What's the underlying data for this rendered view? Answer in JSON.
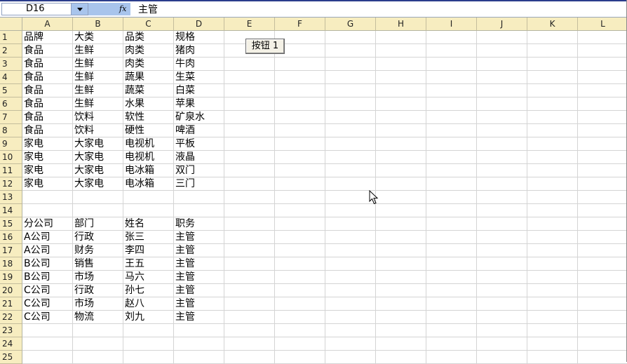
{
  "formula_bar": {
    "name_box_value": "D16",
    "fx_label": "fx",
    "content": "主管"
  },
  "columns": [
    "A",
    "B",
    "C",
    "D",
    "E",
    "F",
    "G",
    "H",
    "I",
    "J",
    "K",
    "L"
  ],
  "rows": [
    "1",
    "2",
    "3",
    "4",
    "5",
    "6",
    "7",
    "8",
    "9",
    "10",
    "11",
    "12",
    "13",
    "14",
    "15",
    "16",
    "17",
    "18",
    "19",
    "20",
    "21",
    "22",
    "23",
    "24",
    "25"
  ],
  "cells": [
    [
      "品牌",
      "大类",
      "品类",
      "规格"
    ],
    [
      "食品",
      "生鲜",
      "肉类",
      "猪肉"
    ],
    [
      "食品",
      "生鲜",
      "肉类",
      "牛肉"
    ],
    [
      "食品",
      "生鲜",
      "蔬果",
      "生菜"
    ],
    [
      "食品",
      "生鲜",
      "蔬菜",
      "白菜"
    ],
    [
      "食品",
      "生鲜",
      "水果",
      "苹果"
    ],
    [
      "食品",
      "饮料",
      "软性",
      "矿泉水"
    ],
    [
      "食品",
      "饮料",
      "硬性",
      "啤酒"
    ],
    [
      "家电",
      "大家电",
      "电视机",
      "平板"
    ],
    [
      "家电",
      "大家电",
      "电视机",
      "液晶"
    ],
    [
      "家电",
      "大家电",
      "电冰箱",
      "双门"
    ],
    [
      "家电",
      "大家电",
      "电冰箱",
      "三门"
    ],
    [
      "",
      "",
      "",
      ""
    ],
    [
      "",
      "",
      "",
      ""
    ],
    [
      "分公司",
      "部门",
      "姓名",
      "职务"
    ],
    [
      "A公司",
      "行政",
      "张三",
      "主管"
    ],
    [
      "A公司",
      "财务",
      "李四",
      "主管"
    ],
    [
      "B公司",
      "销售",
      "王五",
      "主管"
    ],
    [
      "B公司",
      "市场",
      "马六",
      "主管"
    ],
    [
      "C公司",
      "行政",
      "孙七",
      "主管"
    ],
    [
      "C公司",
      "市场",
      "赵八",
      "主管"
    ],
    [
      "C公司",
      "物流",
      "刘九",
      "主管"
    ],
    [
      "",
      "",
      "",
      ""
    ],
    [
      "",
      "",
      "",
      ""
    ],
    [
      "",
      "",
      "",
      ""
    ]
  ],
  "button": {
    "label": "按钮 1"
  },
  "colors": {
    "header_bg": "#f7edc0",
    "namebox_accent": "#a8c4ec",
    "gridline": "#d4d4d4"
  },
  "icons": {
    "cursor": "mouse-pointer-icon",
    "dropdown": "chevron-down-icon"
  }
}
